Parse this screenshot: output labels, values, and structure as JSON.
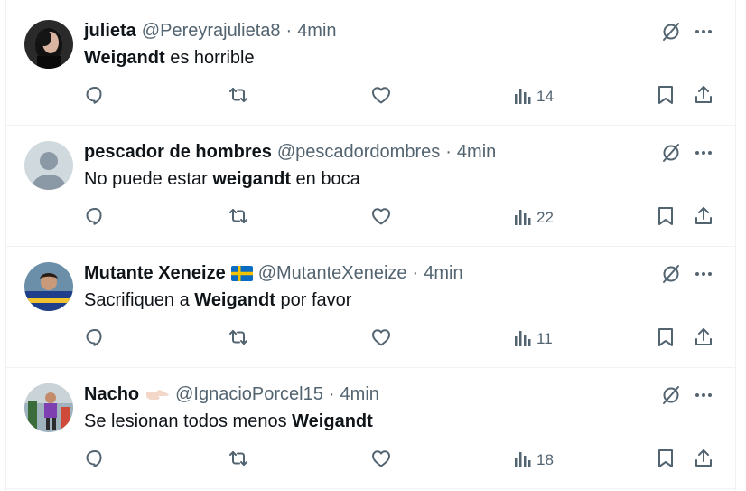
{
  "colors": {
    "text": "#0f1419",
    "secondary": "#536471",
    "divider": "#eff3f4",
    "background": "#ffffff"
  },
  "icons": {
    "top": [
      "grok-icon",
      "more-icon"
    ],
    "actions": [
      "reply-icon",
      "retweet-icon",
      "like-icon",
      "views-icon",
      "bookmark-icon",
      "share-icon"
    ]
  },
  "tweets": [
    {
      "name": "julieta",
      "handle": "@Pereyrajulieta8",
      "separator": "·",
      "time": "4min",
      "text_pre": "",
      "text_bold": "Weigandt",
      "text_post": " es horrible",
      "views": "14"
    },
    {
      "name": "pescador de hombres",
      "handle": "@pescadordombres",
      "separator": "·",
      "time": "4min",
      "text_pre": "No puede estar ",
      "text_bold": "weigandt",
      "text_post": " en boca",
      "views": "22"
    },
    {
      "name": "Mutante Xeneize",
      "emoji": "flag-sweden",
      "handle": "@MutanteXeneize",
      "separator": "·",
      "time": "4min",
      "text_pre": "Sacrifiquen a ",
      "text_bold": "Weigandt",
      "text_post": " por favor",
      "views": "11"
    },
    {
      "name": "Nacho",
      "emoji": "pointing-hand",
      "handle": "@IgnacioPorcel15",
      "separator": "·",
      "time": "4min",
      "text_pre": "Se lesionan todos menos ",
      "text_bold": "Weigandt",
      "text_post": "",
      "views": "18"
    }
  ]
}
